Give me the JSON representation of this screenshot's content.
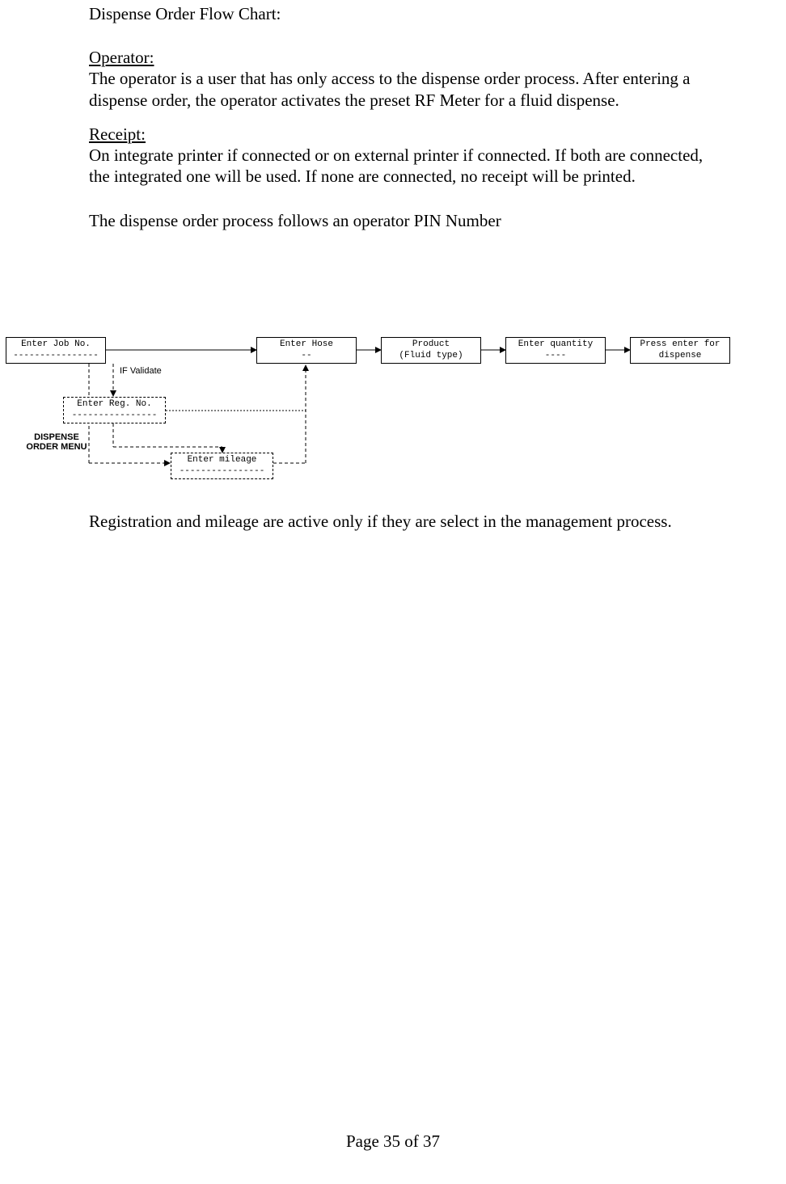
{
  "title": "Dispense Order Flow Chart:",
  "operator_heading": "Operator:",
  "operator_text": "The operator is a user that has only access to the dispense order process. After entering a dispense order, the operator activates the preset RF Meter for a fluid dispense.",
  "receipt_heading": "Receipt:",
  "receipt_text": "On integrate printer if connected or on external printer if connected. If both are connected, the integrated one will be used. If none are connected, no receipt will be printed.",
  "process_text": "The dispense order process follows an operator PIN Number",
  "after_flow_text": "Registration and mileage are active only if they are select in the management process.",
  "footer": "Page 35 of 37",
  "chart_data": {
    "type": "flowchart",
    "boxes": {
      "job": {
        "line1": "Enter Job No.",
        "line2": "----------------"
      },
      "hose": {
        "line1": "Enter Hose",
        "line2": "--"
      },
      "product": {
        "line1": "Product",
        "line2": "(Fluid type)"
      },
      "qty": {
        "line1": "Enter quantity",
        "line2": "----"
      },
      "press": {
        "line1": "Press enter for",
        "line2": "dispense"
      },
      "reg": {
        "line1": "Enter Reg. No.",
        "line2": "----------------"
      },
      "mileage": {
        "line1": "Enter mileage",
        "line2": "----------------"
      }
    },
    "labels": {
      "validate": "IF Validate",
      "menu1": "DISPENSE",
      "menu2": "ORDER MENU"
    }
  }
}
